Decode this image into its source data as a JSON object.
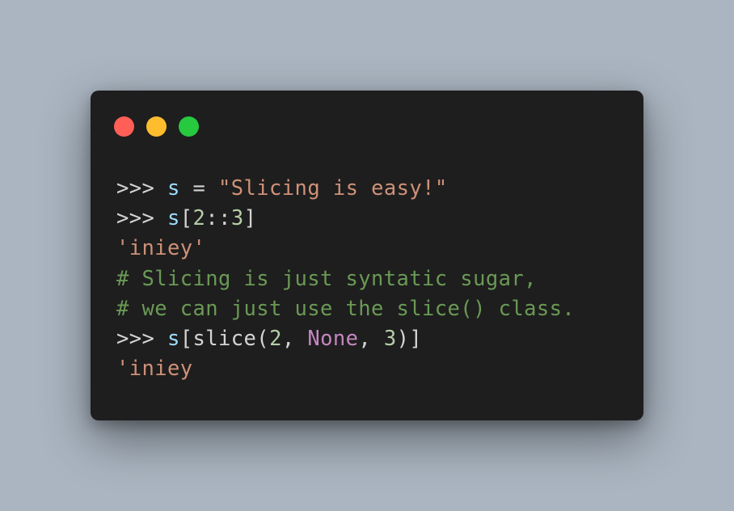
{
  "window": {
    "traffic_lights": [
      {
        "name": "close",
        "color": "#ff5f56"
      },
      {
        "name": "minimize",
        "color": "#ffbd2e"
      },
      {
        "name": "zoom",
        "color": "#27c93f"
      }
    ]
  },
  "colors": {
    "background": "#aab5c1",
    "window": "#1e1e1e",
    "default": "#d4d4d4",
    "variable": "#9cdcfe",
    "string": "#ce9178",
    "number": "#b5cea8",
    "comment": "#6a9955",
    "keyword": "#c586c0"
  },
  "code_lines": [
    [
      {
        "text": ">>> ",
        "type": "default"
      },
      {
        "text": "s",
        "type": "variable"
      },
      {
        "text": " = ",
        "type": "default"
      },
      {
        "text": "\"Slicing is easy!\"",
        "type": "string"
      }
    ],
    [
      {
        "text": ">>> ",
        "type": "default"
      },
      {
        "text": "s",
        "type": "variable"
      },
      {
        "text": "[",
        "type": "default"
      },
      {
        "text": "2",
        "type": "number"
      },
      {
        "text": "::",
        "type": "default"
      },
      {
        "text": "3",
        "type": "number"
      },
      {
        "text": "]",
        "type": "default"
      }
    ],
    [
      {
        "text": "'iniey'",
        "type": "string"
      }
    ],
    [
      {
        "text": "# Slicing is just syntatic sugar,",
        "type": "comment"
      }
    ],
    [
      {
        "text": "# we can just use the slice() class.",
        "type": "comment"
      }
    ],
    [
      {
        "text": ">>> ",
        "type": "default"
      },
      {
        "text": "s",
        "type": "variable"
      },
      {
        "text": "[slice(",
        "type": "default"
      },
      {
        "text": "2",
        "type": "number"
      },
      {
        "text": ", ",
        "type": "default"
      },
      {
        "text": "None",
        "type": "keyword"
      },
      {
        "text": ", ",
        "type": "default"
      },
      {
        "text": "3",
        "type": "number"
      },
      {
        "text": ")]",
        "type": "default"
      }
    ],
    [
      {
        "text": "'iniey",
        "type": "string"
      }
    ]
  ]
}
